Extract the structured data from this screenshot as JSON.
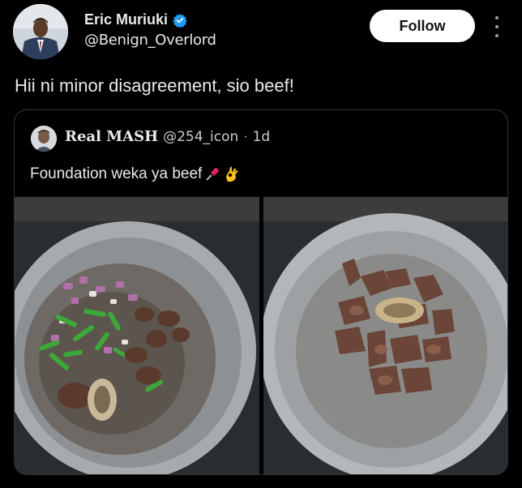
{
  "author": {
    "name": "Eric Muriuki",
    "handle": "@Benign_Overlord",
    "verified": true,
    "avatar_icon": "person-in-suit-avatar"
  },
  "follow_label": "Follow",
  "more_icon": "vertical-ellipsis-icon",
  "tweet": {
    "text": "Hii ni minor disagreement, sio beef!"
  },
  "quoted": {
    "name": "Real MASH",
    "handle": "@254_icon",
    "separator": "·",
    "time": "1d",
    "text": "Foundation weka ya beef",
    "emojis": [
      "pushpin-icon",
      "ok-hand-icon"
    ],
    "photos": [
      {
        "name": "pot-with-onions-peppers-beef"
      },
      {
        "name": "pot-with-beef-chunks"
      }
    ]
  },
  "colors": {
    "background": "#000000",
    "text": "#e7e9ea",
    "verified_blue": "#1d9bf0",
    "border": "#2f3336"
  }
}
